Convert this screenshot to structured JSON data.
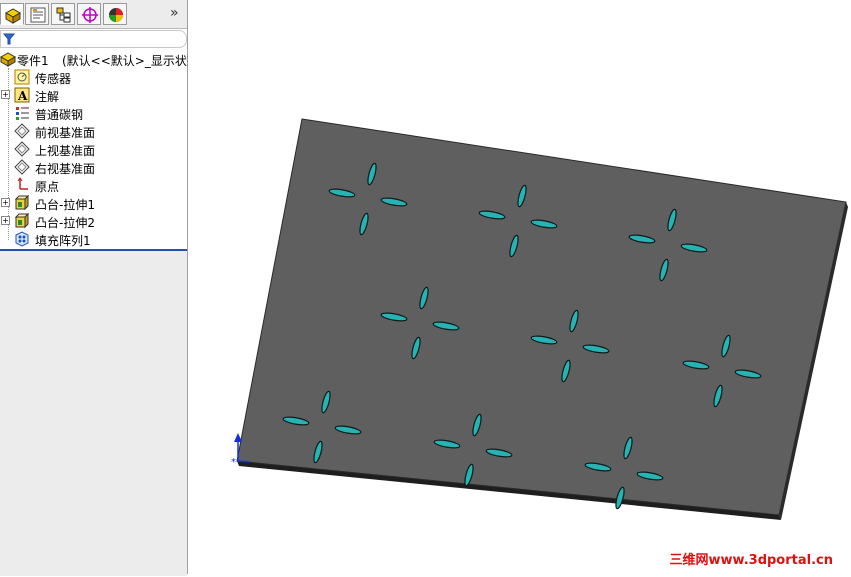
{
  "tabs": [
    {
      "name": "feature-manager-tab",
      "icon": "part-icon"
    },
    {
      "name": "property-manager-tab",
      "icon": "property-icon"
    },
    {
      "name": "configuration-manager-tab",
      "icon": "configuration-icon"
    },
    {
      "name": "dimxpert-manager-tab",
      "icon": "target-icon"
    },
    {
      "name": "display-manager-tab",
      "icon": "appearance-icon"
    }
  ],
  "tab_more_label": "»",
  "tree": {
    "root": {
      "label": "零件1",
      "config": "(默认<<默认>_显示状态"
    },
    "items": [
      {
        "key": "sensors",
        "label": "传感器",
        "icon": "sensor-icon",
        "expandable": false
      },
      {
        "key": "annotations",
        "label": "注解",
        "icon": "annotation-icon",
        "expandable": true
      },
      {
        "key": "material",
        "label": "普通碳钢",
        "icon": "material-icon",
        "expandable": false
      },
      {
        "key": "front-plane",
        "label": "前视基准面",
        "icon": "plane-icon",
        "expandable": false
      },
      {
        "key": "top-plane",
        "label": "上视基准面",
        "icon": "plane-icon",
        "expandable": false
      },
      {
        "key": "right-plane",
        "label": "右视基准面",
        "icon": "plane-icon",
        "expandable": false
      },
      {
        "key": "origin",
        "label": "原点",
        "icon": "origin-icon",
        "expandable": false
      },
      {
        "key": "boss-extrude1",
        "label": "凸台-拉伸1",
        "icon": "extrude-icon",
        "expandable": true
      },
      {
        "key": "boss-extrude2",
        "label": "凸台-拉伸2",
        "icon": "extrude-icon",
        "expandable": true
      },
      {
        "key": "fill-pattern1",
        "label": "填充阵列1",
        "icon": "fill-pattern-icon",
        "expandable": false
      }
    ]
  },
  "watermark": "三维网www.3dportal.cn",
  "colors": {
    "plate": "#5f5f5f",
    "plate_edge": "#2a2a2a",
    "slot": "#27b3b3",
    "accent": "#2050b0"
  }
}
